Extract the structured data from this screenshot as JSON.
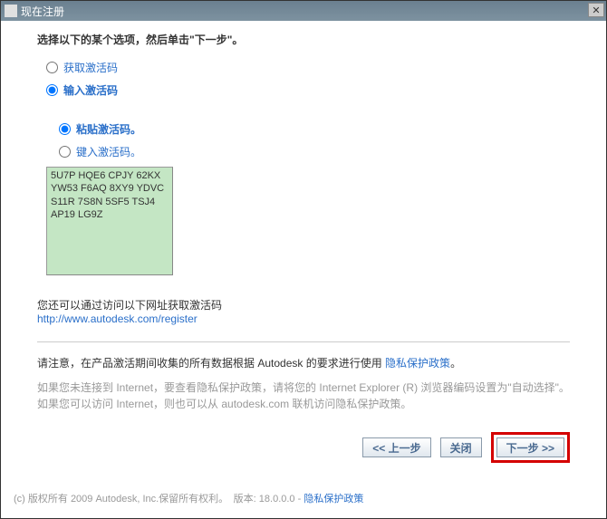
{
  "titlebar": {
    "title": "现在注册"
  },
  "instruction": "选择以下的某个选项，然后单击\"下一步\"。",
  "radio_main": {
    "get_code": "获取激活码",
    "enter_code": "输入激活码"
  },
  "radio_sub": {
    "paste": "粘贴激活码。",
    "type": "键入激活码。"
  },
  "activation_code": "5U7P HQE6 CPJY 62KX\nYW53 F6AQ 8XY9 YDVC\nS11R 7S8N 5SF5 TSJ4\nAP19 LG9Z",
  "url_block": {
    "text": "您还可以通过访问以下网址获取激活码",
    "url": "http://www.autodesk.com/register"
  },
  "notice": {
    "prefix": "请注意，在产品激活期间收集的所有数据根据 Autodesk 的要求进行使用 ",
    "link": "隐私保护政策",
    "suffix": "。"
  },
  "gray_text": "如果您未连接到 Internet，要查看隐私保护政策，请将您的 Internet Explorer (R) 浏览器编码设置为\"自动选择\"。如果您可以访问 Internet，则也可以从 autodesk.com 联机访问隐私保护政策。",
  "buttons": {
    "back": "<< 上一步",
    "close": "关闭",
    "next": "下一步 >>"
  },
  "footer": {
    "text": "(c) 版权所有 2009 Autodesk, Inc.保留所有权利。　版本: 18.0.0.0 - ",
    "link": "隐私保护政策"
  }
}
